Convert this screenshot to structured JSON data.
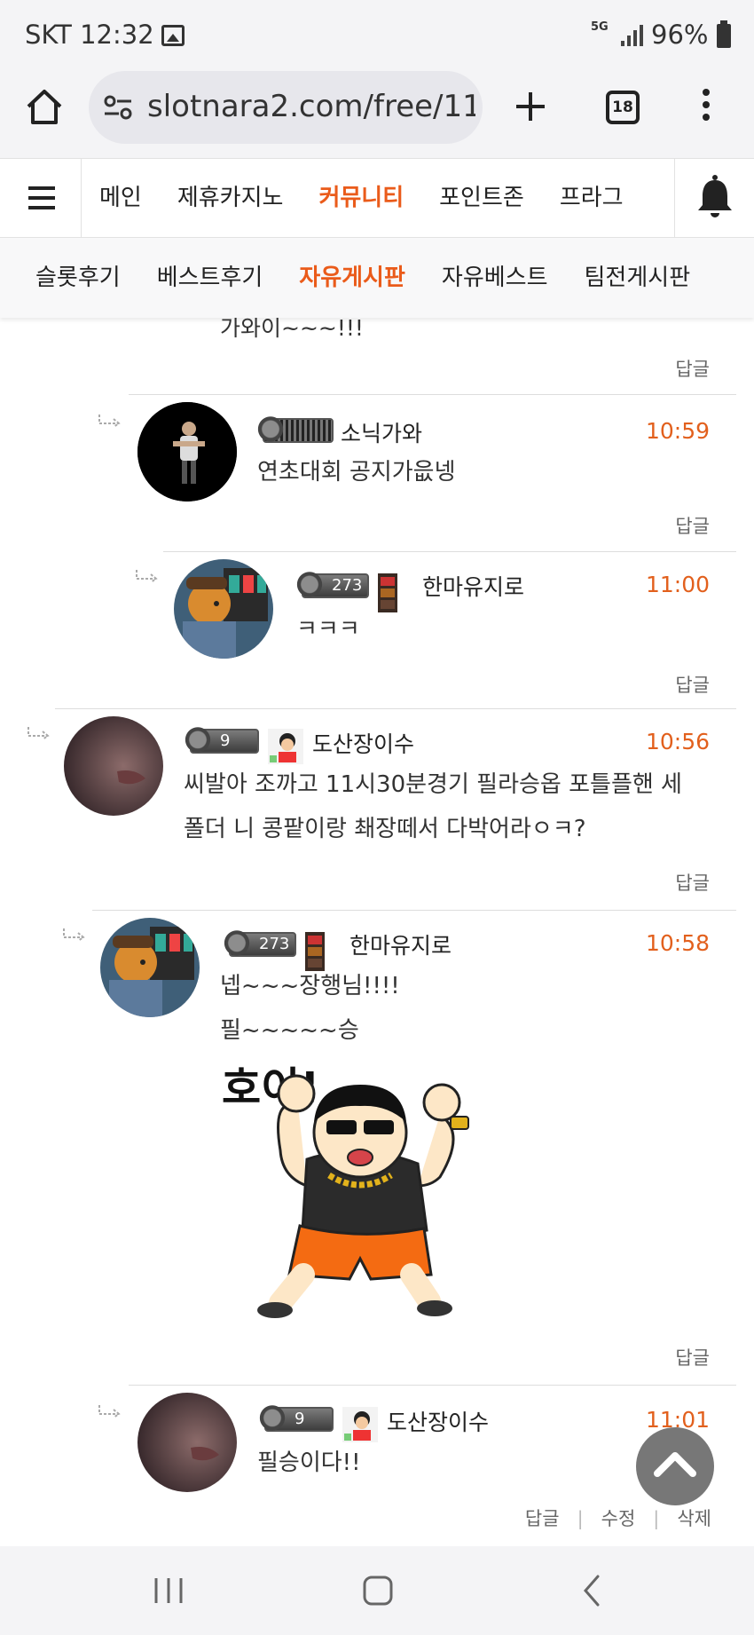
{
  "status_bar": {
    "carrier_time": "SKT 12:32",
    "network": "5G",
    "battery": "96%"
  },
  "browser": {
    "url": "slotnara2.com/free/11",
    "tab_count": "18"
  },
  "site_nav": {
    "items": [
      {
        "label": "메인",
        "active": false
      },
      {
        "label": "제휴카지노",
        "active": false
      },
      {
        "label": "커뮤니티",
        "active": true
      },
      {
        "label": "포인트존",
        "active": false
      },
      {
        "label": "프라그",
        "active": false
      }
    ]
  },
  "sub_nav": {
    "items": [
      {
        "label": "슬롯후기",
        "active": false
      },
      {
        "label": "베스트후기",
        "active": false
      },
      {
        "label": "자유게시판",
        "active": true
      },
      {
        "label": "자유베스트",
        "active": false
      },
      {
        "label": "팀전게시판",
        "active": false
      }
    ]
  },
  "fragment": {
    "text": "가와이~~~!!!",
    "reply_label": "답글"
  },
  "comments": [
    {
      "nick": "소닉가와",
      "time": "10:59",
      "lines": [
        "연초대회 공지가읎넹"
      ],
      "reply": "답글"
    },
    {
      "nick": "한마유지로",
      "level": "273",
      "time": "11:00",
      "lines": [
        "ㅋㅋㅋ"
      ],
      "reply": "답글"
    },
    {
      "nick": "도산장이수",
      "level": "9",
      "time": "10:56",
      "lines": [
        "씨발아 조까고 11시30분경기 필라승옵 포틀플핸 세",
        "폴더 니 콩팥이랑 쵀장떼서 다박어라ㅇㅋ?"
      ],
      "reply": "답글"
    },
    {
      "nick": "한마유지로",
      "level": "273",
      "time": "10:58",
      "lines": [
        "넵~~~장행님!!!!",
        "필~~~~~승"
      ],
      "sticker_text": "호이!",
      "reply": "답글"
    },
    {
      "nick": "도산장이수",
      "level": "9",
      "time": "11:01",
      "lines": [
        "필승이다!!"
      ],
      "actions": [
        "답글",
        "수정",
        "삭제"
      ]
    }
  ],
  "colors": {
    "accent": "#ea5b1a",
    "time": "#e2601d"
  }
}
